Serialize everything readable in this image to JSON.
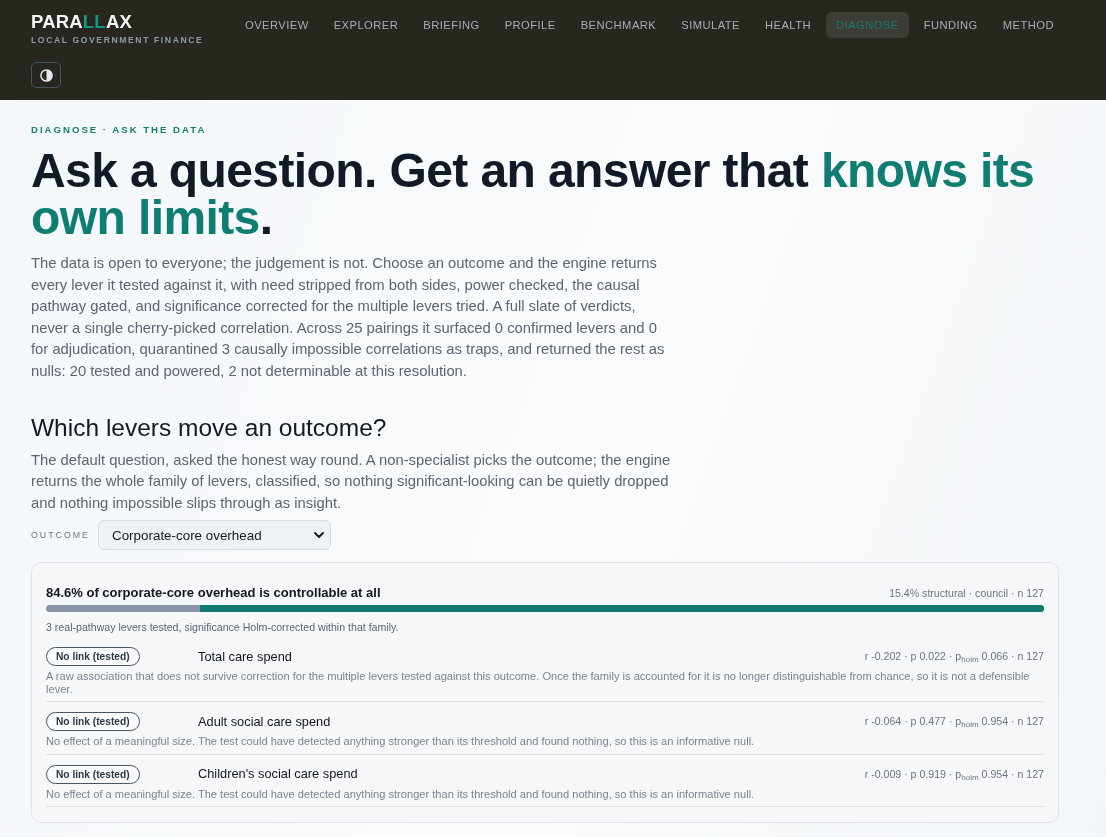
{
  "header": {
    "logo": [
      {
        "text": "PARA",
        "highlight": false
      },
      {
        "text": "LL",
        "highlight": true
      },
      {
        "text": "AX",
        "highlight": false
      }
    ],
    "tagline": "LOCAL GOVERNMENT FINANCE",
    "nav": [
      {
        "label": "OVERVIEW",
        "selected": false
      },
      {
        "label": "EXPLORER",
        "selected": false
      },
      {
        "label": "BRIEFING",
        "selected": false
      },
      {
        "label": "PROFILE",
        "selected": false
      },
      {
        "label": "BENCHMARK",
        "selected": false
      },
      {
        "label": "SIMULATE",
        "selected": false
      },
      {
        "label": "HEALTH",
        "selected": false
      },
      {
        "label": "DIAGNOSE",
        "selected": true
      },
      {
        "label": "FUNDING",
        "selected": false
      },
      {
        "label": "METHOD",
        "selected": false
      }
    ]
  },
  "page": {
    "eyebrow": "DIAGNOSE · ASK THE DATA",
    "title": [
      {
        "text": "Ask a question. Get an answer that ",
        "highlight": false
      },
      {
        "text": "knows its own limits",
        "highlight": true
      },
      {
        "text": ".",
        "highlight": false
      }
    ],
    "intro": "The data is open to everyone; the judgement is not. Choose an outcome and the engine returns every lever it tested against it, with need stripped from both sides, power checked, the causal pathway gated, and significance corrected for the multiple levers tried. A full slate of verdicts, never a single cherry-picked correlation. Across 25 pairings it surfaced 0 confirmed levers and 0 for adjudication, quarantined 3 causally impossible correlations as traps, and returned the rest as nulls: 20 tested and powered, 2 not determinable at this resolution.",
    "section": {
      "heading": "Which levers move an outcome?",
      "text": "The default question, asked the honest way round. A non-specialist picks the outcome; the engine returns the whole family of levers, classified, so nothing significant-looking can be quietly dropped and nothing impossible slips through as insight.",
      "outcome": {
        "label": "OUTCOME",
        "value": "Corporate-core overhead"
      }
    },
    "result": {
      "headline": "84.6% of corporate-core overhead is controllable at all",
      "meta": "15.4% structural · council · n 127",
      "level": 0.846,
      "note": "3 real-pathway levers tested, significance Holm-corrected within that family.",
      "levers": [
        {
          "verdict": "No link (tested)",
          "name": "Total care spend",
          "stats": "r -0.202 · p 0.022 · p$_{holm}$ 0.066 · n 127",
          "explanation": "A raw association that does not survive correction for the multiple levers tested against this outcome. Once the family is accounted for it is no longer distinguishable from chance, so it is not a defensible lever."
        },
        {
          "verdict": "No link (tested)",
          "name": "Adult social care spend",
          "stats": "r -0.064 · p 0.477 · p$_{holm}$ 0.954 · n 127",
          "explanation": "No effect of a meaningful size. The test could have detected anything stronger than its threshold and found nothing, so this is an informative null."
        },
        {
          "verdict": "No link (tested)",
          "name": "Children's social care spend",
          "stats": "r -0.009 · p 0.919 · p$_{holm}$ 0.954 · n 127",
          "explanation": "No effect of a meaningful size. The test could have detected anything stronger than its threshold and found nothing, so this is an informative null."
        }
      ]
    }
  }
}
